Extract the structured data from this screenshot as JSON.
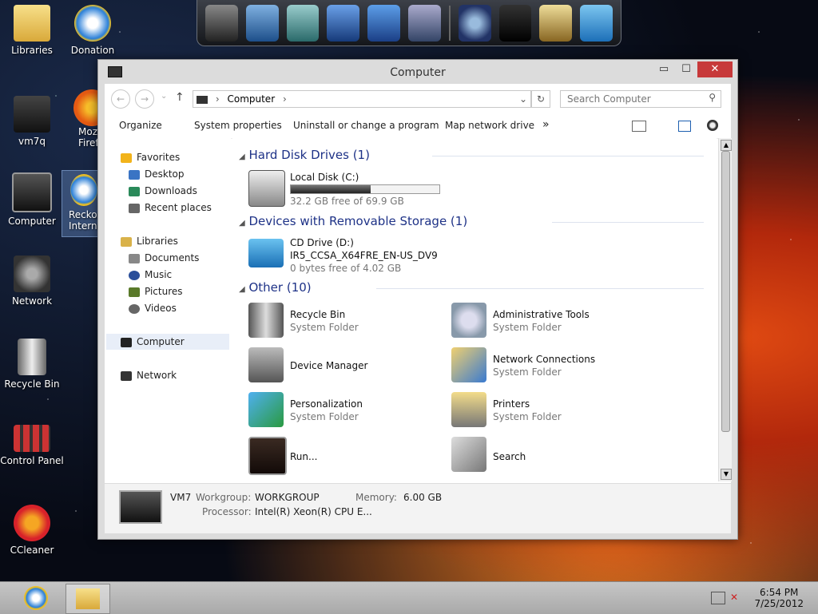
{
  "desktop": {
    "icons": [
      {
        "label": "Libraries"
      },
      {
        "label": "Donation"
      },
      {
        "label": "vm7q"
      },
      {
        "label": "Moz\nFiref"
      },
      {
        "label": "Computer"
      },
      {
        "label": "Recko\nInternat"
      },
      {
        "label": "Network"
      },
      {
        "label": "Recycle Bin"
      },
      {
        "label": "Control Panel"
      },
      {
        "label": "CCleaner"
      }
    ]
  },
  "window": {
    "title": "Computer",
    "min": "▭",
    "max": "☐",
    "close": "✕"
  },
  "address": {
    "back": "←",
    "forward": "→",
    "up": "↑",
    "path": "Computer",
    "path_arrow": "›",
    "dropdown": "⌄",
    "refresh": "↻",
    "search_placeholder": "Search Computer",
    "search_icon": "⚲"
  },
  "toolbar": {
    "organize": "Organize",
    "system_properties": "System properties",
    "uninstall": "Uninstall or change a program",
    "map_drive": "Map network drive",
    "more": "»"
  },
  "nav": {
    "favorites": "Favorites",
    "desktop": "Desktop",
    "downloads": "Downloads",
    "recent": "Recent places",
    "libraries": "Libraries",
    "documents": "Documents",
    "music": "Music",
    "pictures": "Pictures",
    "videos": "Videos",
    "computer": "Computer",
    "network": "Network"
  },
  "content": {
    "hdd_group": "Hard Disk Drives (1)",
    "local_disk": {
      "name": "Local Disk (C:)",
      "free": "32.2 GB free of 69.9 GB",
      "used_fraction": 0.54
    },
    "removable_group": "Devices with Removable Storage (1)",
    "cd": {
      "name": "CD Drive (D:)",
      "label": "IR5_CCSA_X64FRE_EN-US_DV9",
      "free": "0 bytes free of 4.02 GB"
    },
    "other_group": "Other (10)",
    "items": [
      {
        "name": "Recycle Bin",
        "sub": "System Folder"
      },
      {
        "name": "Administrative Tools",
        "sub": "System Folder"
      },
      {
        "name": "Device Manager",
        "sub": ""
      },
      {
        "name": "Network Connections",
        "sub": "System Folder"
      },
      {
        "name": "Personalization",
        "sub": "System Folder"
      },
      {
        "name": "Printers",
        "sub": "System Folder"
      },
      {
        "name": "Run...",
        "sub": ""
      },
      {
        "name": "Search",
        "sub": ""
      }
    ]
  },
  "details": {
    "name": "VM7",
    "workgroup_label": "Workgroup:",
    "workgroup": "WORKGROUP",
    "memory_label": "Memory:",
    "memory": "6.00 GB",
    "processor_label": "Processor:",
    "processor": "Intel(R) Xeon(R) CPU E..."
  },
  "taskbar": {
    "time": "6:54 PM",
    "date": "7/25/2012"
  }
}
